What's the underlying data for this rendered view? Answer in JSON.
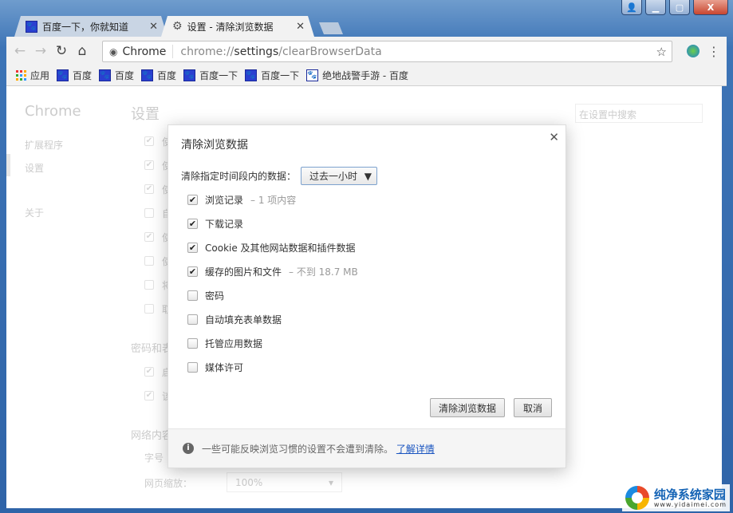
{
  "window": {
    "controls": [
      "user",
      "minimize",
      "maximize",
      "close"
    ]
  },
  "tabs": [
    {
      "title": "百度一下，你就知道",
      "icon": "baidu-paw-icon",
      "active": false
    },
    {
      "title": "设置 - 清除浏览数据",
      "icon": "gear-icon",
      "active": true
    }
  ],
  "toolbar": {
    "chip": "Chrome",
    "url_prefix": "chrome://",
    "url_host": "settings",
    "url_path": "/clearBrowserData"
  },
  "bookmarks": [
    "应用",
    "百度",
    "百度",
    "百度",
    "百度一下",
    "百度一下",
    "绝地战警手游 - 百度"
  ],
  "settings_bg": {
    "brand": "Chrome",
    "title": "设置",
    "search_placeholder": "在设置中搜索",
    "nav": [
      "扩展程序",
      "设置",
      "关于"
    ],
    "row_fragments": [
      "使",
      "使",
      "使",
      "自",
      "使",
      "使",
      "将",
      "取"
    ],
    "section_password": "密码和表",
    "password_fragments": [
      "启",
      "该"
    ],
    "section_web": "网络内容",
    "font_label": "字号",
    "zoom_label": "网页缩放：",
    "zoom_value": "100%"
  },
  "dialog": {
    "title": "清除浏览数据",
    "range_label": "清除指定时间段内的数据：",
    "range_value": "过去一小时",
    "options": [
      {
        "label": "浏览记录",
        "sub": "– 1 项内容",
        "checked": true
      },
      {
        "label": "下载记录",
        "sub": "",
        "checked": true
      },
      {
        "label": "Cookie 及其他网站数据和插件数据",
        "sub": "",
        "checked": true
      },
      {
        "label": "缓存的图片和文件",
        "sub": "– 不到 18.7 MB",
        "checked": true
      },
      {
        "label": "密码",
        "sub": "",
        "checked": false
      },
      {
        "label": "自动填充表单数据",
        "sub": "",
        "checked": false
      },
      {
        "label": "托管应用数据",
        "sub": "",
        "checked": false
      },
      {
        "label": "媒体许可",
        "sub": "",
        "checked": false
      }
    ],
    "clear_button": "清除浏览数据",
    "cancel_button": "取消",
    "footer_text": "一些可能反映浏览习惯的设置不会遭到清除。",
    "footer_link": "了解详情"
  },
  "watermark": {
    "name": "纯净系统家园",
    "url": "www.yidaimei.com"
  }
}
